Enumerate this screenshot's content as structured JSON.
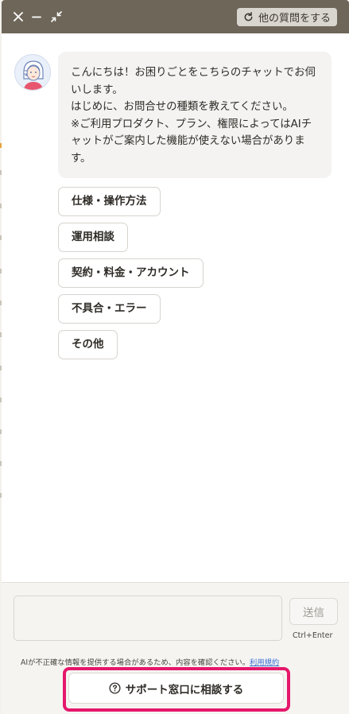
{
  "header": {
    "close_icon": "close-icon",
    "minimize_icon": "minimize-icon",
    "shrink_icon": "shrink-icon",
    "new_question_label": "他の質問をする"
  },
  "chat": {
    "avatar_icon": "assistant-avatar",
    "message_lines": [
      "こんにちは！お困りごとをこちらのチャットでお伺いします。",
      "はじめに、お問合せの種類を教えてください。",
      "※ご利用プロダクト、プラン、権限によってはAIチャットがご案内した機能が使えない場合があります。"
    ],
    "options": [
      "仕様・操作方法",
      "運用相談",
      "契約・料金・アカウント",
      "不具合・エラー",
      "その他"
    ]
  },
  "footer": {
    "input_value": "",
    "send_label": "送信",
    "send_hint": "Ctrl+Enter",
    "disclaimer": "AIが不正確な情報を提供する場合があるため、内容を確認ください。",
    "terms_link": "利用規約",
    "support_label": "サポート窓口に相談する",
    "colors": {
      "header_bg": "#6e6659",
      "highlight": "#e5176b",
      "link": "#3b6fd4"
    }
  }
}
